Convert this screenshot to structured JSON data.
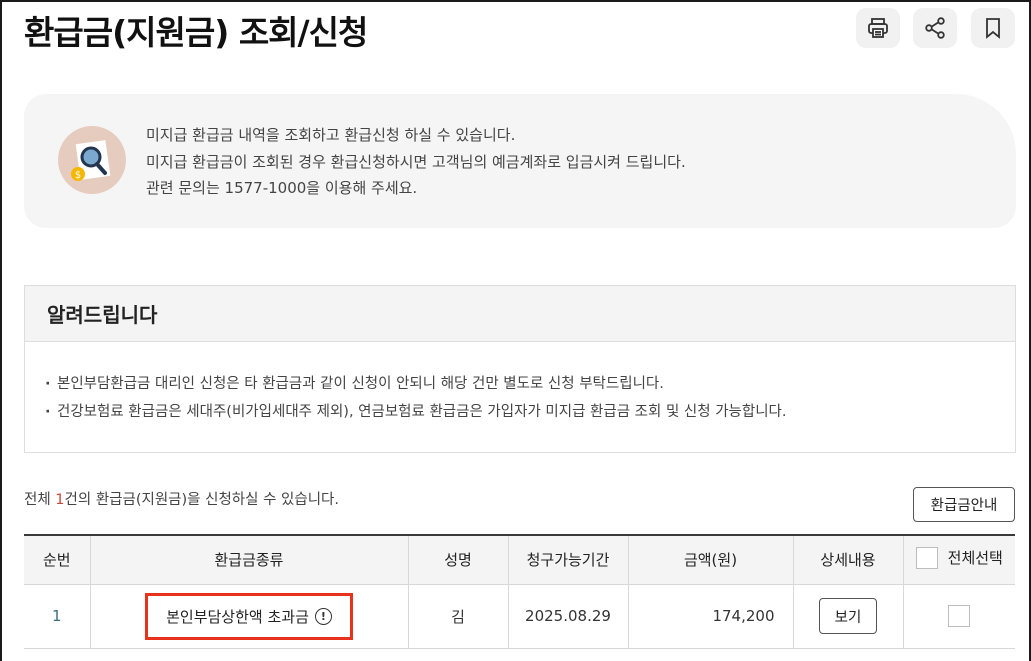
{
  "page": {
    "title": "환급금(지원금) 조회/신청"
  },
  "toolbar": {
    "print_icon": "printer-icon",
    "share_icon": "share-icon",
    "bookmark_icon": "bookmark-icon"
  },
  "info": {
    "icon": "search-refund-icon",
    "line1": "미지급 환급금 내역을 조회하고 환급신청 하실 수 있습니다.",
    "line2": "미지급 환급금이 조회된 경우 환급신청하시면 고객님의 예금계좌로 입금시켜 드립니다.",
    "line3": "관련 문의는 1577-1000을 이용해 주세요."
  },
  "notice": {
    "heading": "알려드립니다",
    "items": [
      "본인부담환급금 대리인 신청은 타 환급금과 같이 신청이 안되니 해당 건만 별도로 신청 부탁드립니다.",
      "건강보험료 환급금은 세대주(비가입세대주 제외), 연금보험료 환급금은 가입자가 미지급 환급금 조회 및 신청 가능합니다."
    ]
  },
  "summary": {
    "prefix": "전체 ",
    "count": "1",
    "suffix": "건의 환급금(지원금)을 신청하실 수 있습니다."
  },
  "guide_button": "환급금안내",
  "table": {
    "headers": {
      "no": "순번",
      "type": "환급금종류",
      "name": "성명",
      "period": "청구가능기간",
      "amount": "금액(원)",
      "detail": "상세내용",
      "select_all": "전체선택"
    },
    "rows": [
      {
        "no": "1",
        "type": "본인부담상한액 초과금",
        "name": "김",
        "period": "2025.08.29",
        "amount": "174,200",
        "detail_button": "보기"
      }
    ]
  },
  "colors": {
    "accent_count": "#c84a3a",
    "highlight_border": "#e8321c",
    "info_bg": "#f5f5f5"
  }
}
